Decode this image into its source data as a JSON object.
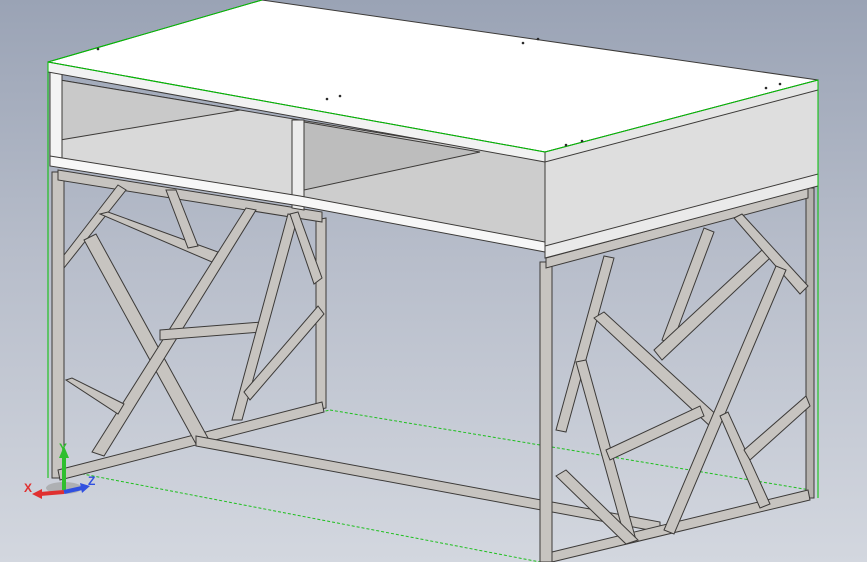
{
  "viewport": {
    "background_top": "#9aa3b5",
    "background_bottom": "#d3d7df"
  },
  "model": {
    "panel_color": "#ffffff",
    "panel_shade": "#d9d9d9",
    "panel_dark": "#bdbdbd",
    "frame_color": "#c7c4c0",
    "frame_edge": "#3c3a38",
    "edge_highlight": "#00c000"
  },
  "triad": {
    "x_label": "X",
    "y_label": "Y",
    "z_label": "Z",
    "x_color": "#e03030",
    "y_color": "#2fbf2f",
    "z_color": "#3050e0"
  }
}
